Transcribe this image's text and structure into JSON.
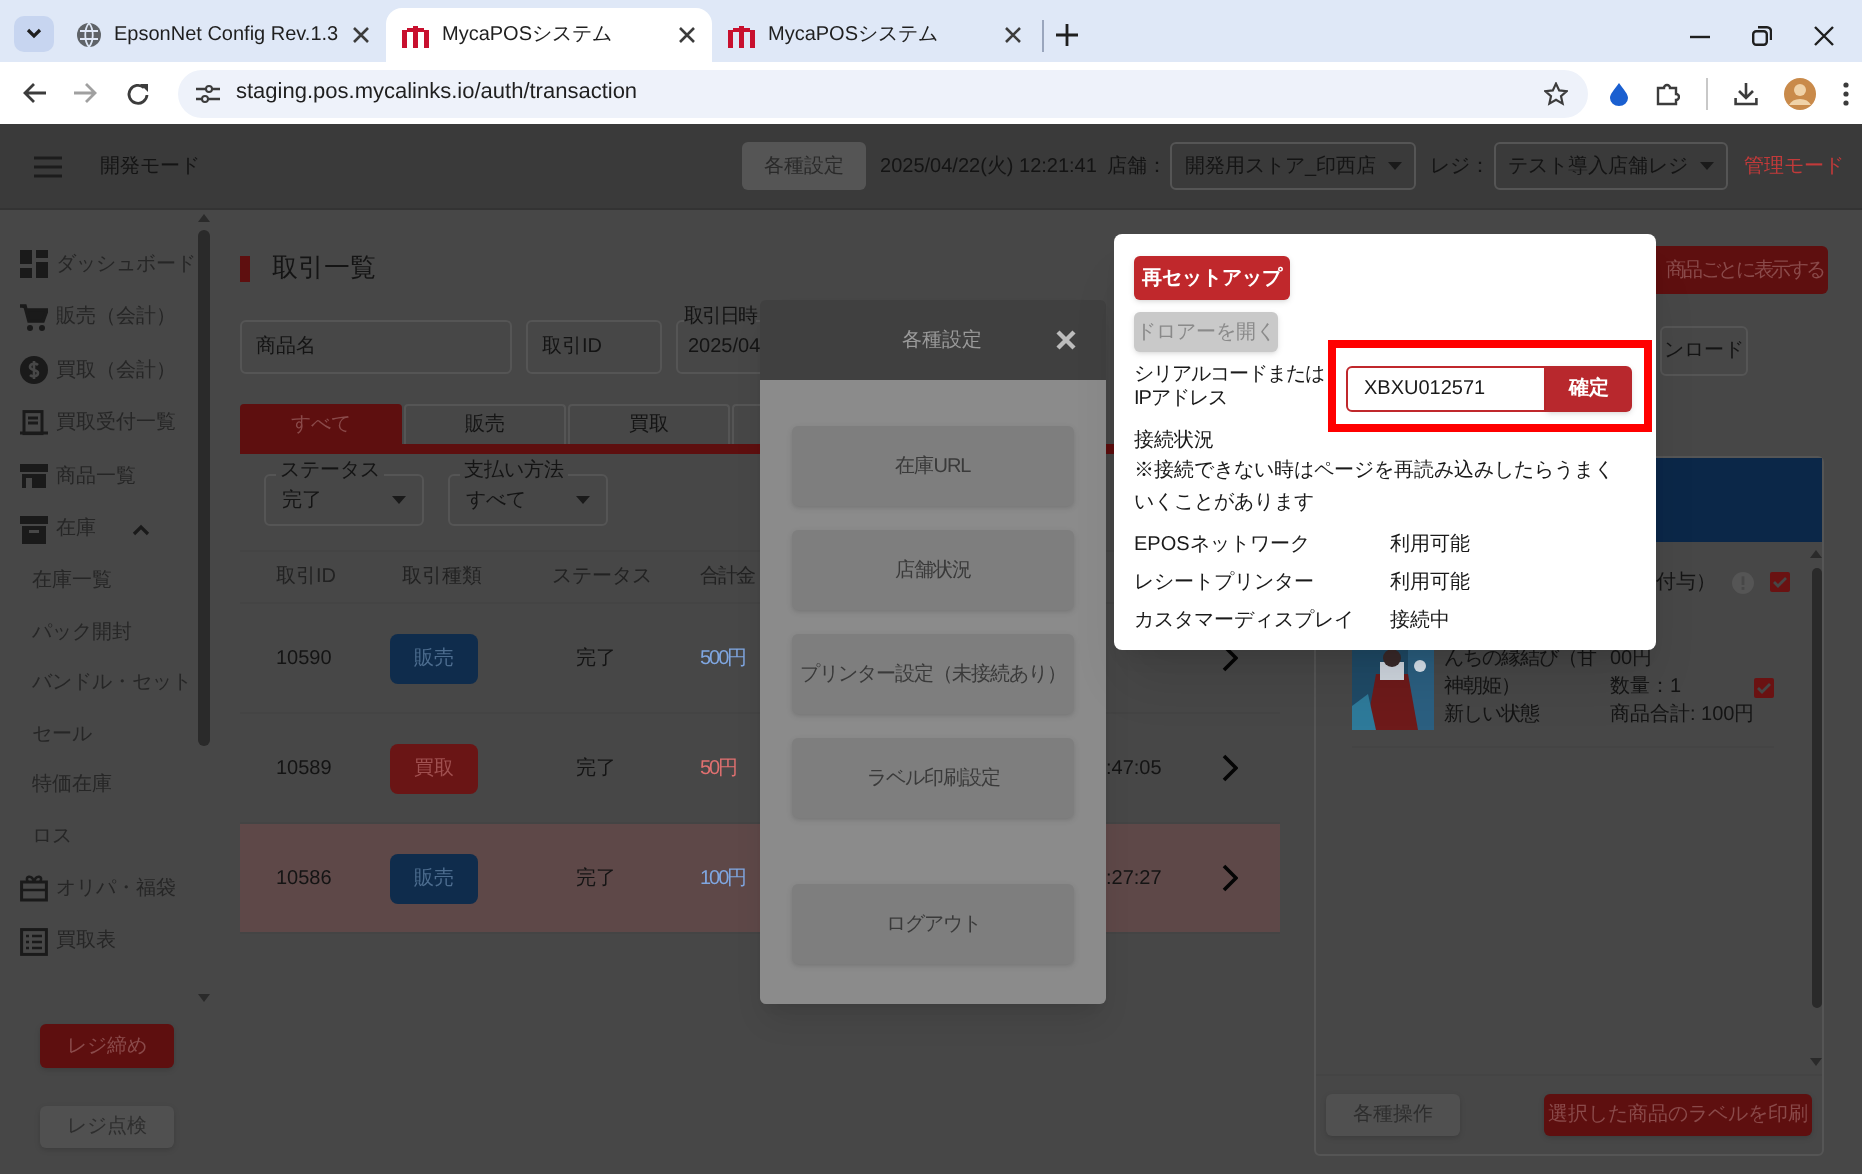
{
  "browser": {
    "tabs": [
      {
        "kind": "web",
        "title": "EpsonNet Config Rev.1.3",
        "selected": false
      },
      {
        "kind": "app",
        "title": "MycaPOSシステム",
        "selected": true
      },
      {
        "kind": "app",
        "title": "MycaPOSシステム",
        "selected": false
      }
    ],
    "url": "staging.pos.mycalinks.io/auth/transaction"
  },
  "header": {
    "mode": "開発モード",
    "settings_button": "各種設定",
    "datetime": "2025/04/22(火) 12:21:41",
    "store_label": "店舗：",
    "store": "開発用ストア_印西店",
    "register_label": "レジ：",
    "register": "テスト導入店舗レジ",
    "admin_mode": "管理モード"
  },
  "sidebar": {
    "items": [
      {
        "label": "ダッシュボード"
      },
      {
        "label": "販売（会計）"
      },
      {
        "label": "買取（会計）"
      },
      {
        "label": "買取受付一覧"
      },
      {
        "label": "商品一覧"
      },
      {
        "label": "在庫",
        "expanded": true,
        "children": [
          {
            "label": "在庫一覧"
          },
          {
            "label": "パック開封"
          },
          {
            "label": "バンドル・セット"
          },
          {
            "label": "セール"
          },
          {
            "label": "特価在庫"
          },
          {
            "label": "ロス"
          }
        ]
      },
      {
        "label": "オリパ・福袋"
      },
      {
        "label": "買取表"
      }
    ],
    "buttons": [
      {
        "label": "レジ締め",
        "kind": "primary"
      },
      {
        "label": "レジ点検",
        "kind": "secondary"
      }
    ]
  },
  "transactions": {
    "title": "取引一覧",
    "fields": [
      {
        "placeholder": "商品名"
      },
      {
        "placeholder": "取引ID"
      },
      {
        "label": "取引日時",
        "value": "2025/04"
      }
    ],
    "tabs": [
      {
        "label": "すべて",
        "selected": true
      },
      {
        "label": "販売",
        "selected": false
      },
      {
        "label": "買取",
        "selected": false
      }
    ],
    "filters": [
      {
        "label": "ステータス",
        "value": "完了"
      },
      {
        "label": "支払い方法",
        "value": "すべて"
      }
    ],
    "columns": [
      "取引ID",
      "取引種類",
      "ステータス",
      "合計金"
    ],
    "rows": [
      {
        "id": "10590",
        "type": "販売",
        "kind": "sale",
        "status": "完了",
        "total": "500円",
        "selected": false
      },
      {
        "id": "10589",
        "type": "買取",
        "kind": "purchase",
        "status": "完了",
        "total": "50円",
        "time": ":47:05",
        "selected": false
      },
      {
        "id": "10586",
        "type": "販売",
        "kind": "sale",
        "status": "完了",
        "total": "100円",
        "time": ":27:27",
        "selected": true
      }
    ]
  },
  "detail_panel": {
    "view_button": "商品ごとに表示する",
    "download_button": "ンロード",
    "header_note": "付与）",
    "header_checked": true,
    "item": {
      "name_lines": [
        "んちの縁結び（甘",
        "神朝姫）"
      ],
      "condition": "新しい状態",
      "price": "00円",
      "quantity": "数量：1",
      "subtotal": "商品合計: 100円",
      "checked": true
    },
    "buttons": [
      {
        "label": "各種操作",
        "kind": "secondary"
      },
      {
        "label": "選択した商品のラベルを印刷",
        "kind": "primary"
      }
    ]
  },
  "settings_dialog": {
    "title": "各種設定",
    "buttons": [
      "在庫URL",
      "店舗状況",
      "プリンター設定（未接続あり）",
      "ラベル印刷設定"
    ],
    "logout_button": "ログアウト"
  },
  "printer_popup": {
    "setup_button": "再セットアップ",
    "drawer_button": {
      "label": "ドロアーを開く",
      "disabled": true
    },
    "serial_label": "シリアルコードまたは\nIPアドレス",
    "serial_value": "XBXU012571",
    "confirm_button": "確定",
    "status_label": "接続状況",
    "note": "※接続できない時はページを再読み込みしたらうまくいくことがあります",
    "statuses": [
      {
        "name": "EPOSネットワーク",
        "value": "利用可能"
      },
      {
        "name": "レシートプリンター",
        "value": "利用可能"
      },
      {
        "name": "カスタマーディスプレイ",
        "value": "接続中"
      }
    ]
  }
}
